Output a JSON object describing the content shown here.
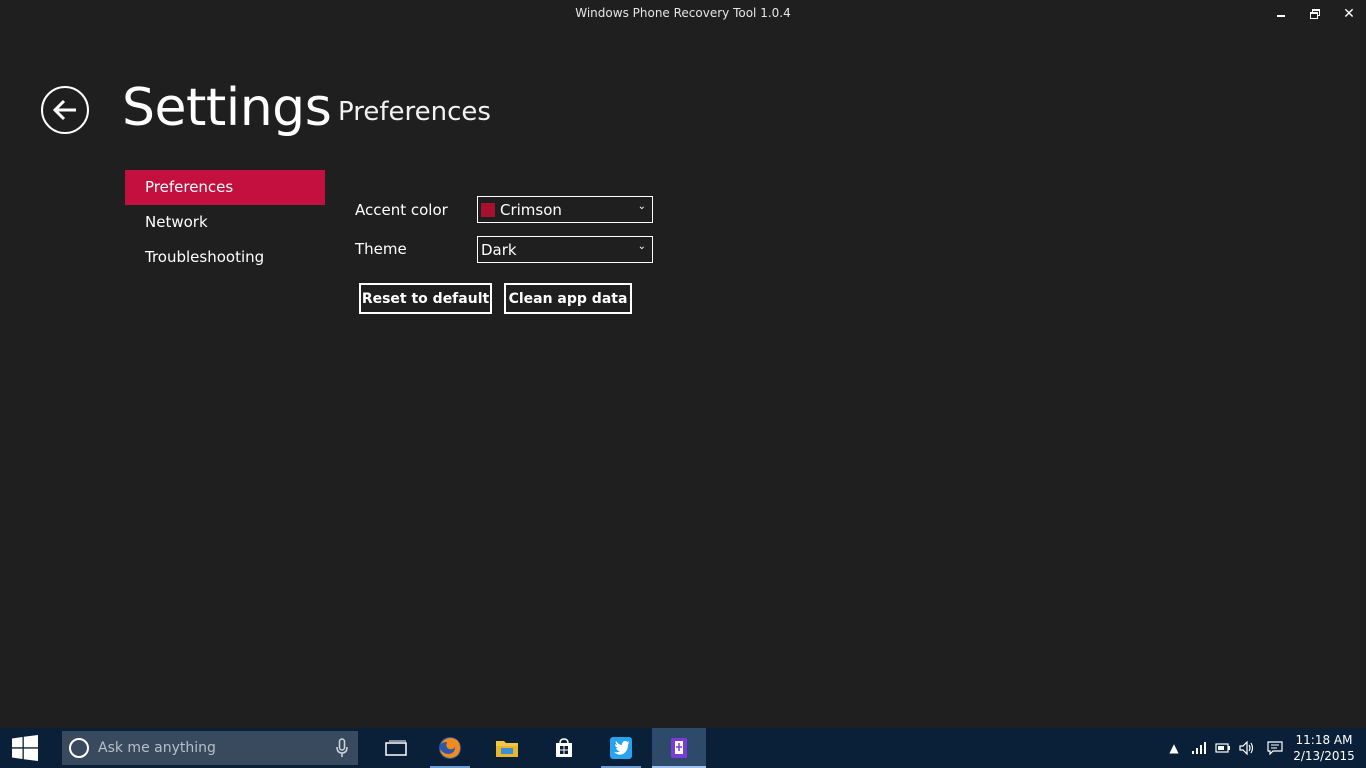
{
  "window": {
    "title": "Windows Phone Recovery Tool 1.0.4",
    "controls": [
      "minimize-icon",
      "restore-icon",
      "close-icon"
    ]
  },
  "header": {
    "title": "Settings",
    "subtitle": "Preferences"
  },
  "nav": {
    "items": [
      {
        "label": "Preferences",
        "active": true
      },
      {
        "label": "Network",
        "active": false
      },
      {
        "label": "Troubleshooting",
        "active": false
      }
    ]
  },
  "preferences": {
    "accent_label": "Accent color",
    "accent_value": "Crimson",
    "accent_swatch": "#a8102f",
    "theme_label": "Theme",
    "theme_value": "Dark",
    "reset_button": "Reset to default",
    "clean_button": "Clean app data"
  },
  "taskbar": {
    "search_placeholder": "Ask me anything",
    "apps": [
      "task-view-icon",
      "firefox-icon",
      "file-explorer-icon",
      "store-icon",
      "twitter-icon",
      "phone-recovery-icon"
    ],
    "time": "11:18 AM",
    "date": "2/13/2015"
  },
  "colors": {
    "accent": "#c3103e",
    "background": "#1f1f1f",
    "taskbar": "#0a1f38"
  }
}
